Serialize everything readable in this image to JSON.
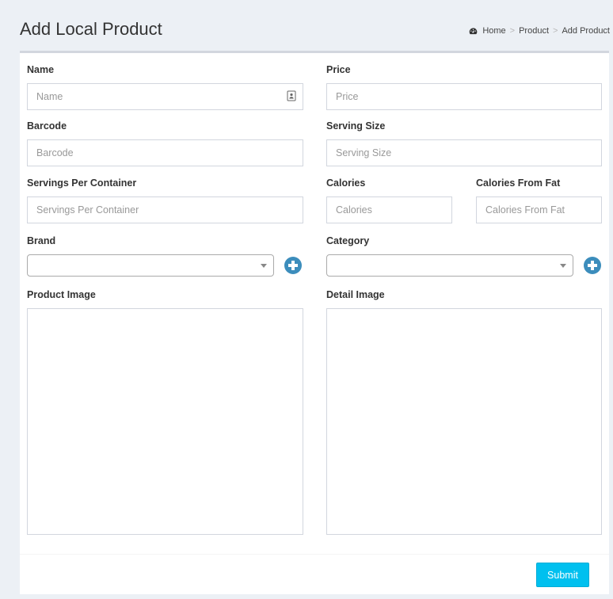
{
  "header": {
    "title": "Add Local Product",
    "breadcrumb": {
      "home_icon": "dashboard-icon",
      "home": "Home",
      "separator": ">",
      "product": "Product",
      "current": "Add Product"
    }
  },
  "form": {
    "name": {
      "label": "Name",
      "placeholder": "Name",
      "icon": "address-card-icon"
    },
    "price": {
      "label": "Price",
      "placeholder": "Price"
    },
    "barcode": {
      "label": "Barcode",
      "placeholder": "Barcode"
    },
    "serving_size": {
      "label": "Serving Size",
      "placeholder": "Serving Size"
    },
    "servings_per_container": {
      "label": "Servings Per Container",
      "placeholder": "Servings Per Container"
    },
    "calories": {
      "label": "Calories",
      "placeholder": "Calories"
    },
    "calories_from_fat": {
      "label": "Calories From Fat",
      "placeholder": "Calories From Fat"
    },
    "brand": {
      "label": "Brand",
      "value": "",
      "add_icon": "plus-circle-icon"
    },
    "category": {
      "label": "Category",
      "value": "",
      "add_icon": "plus-circle-icon"
    },
    "product_image": {
      "label": "Product Image"
    },
    "detail_image": {
      "label": "Detail Image"
    }
  },
  "footer": {
    "submit_label": "Submit"
  },
  "colors": {
    "primary": "#3c8dbc",
    "info": "#00c0ef",
    "background": "#ecf0f5",
    "border": "#d2d6de"
  }
}
